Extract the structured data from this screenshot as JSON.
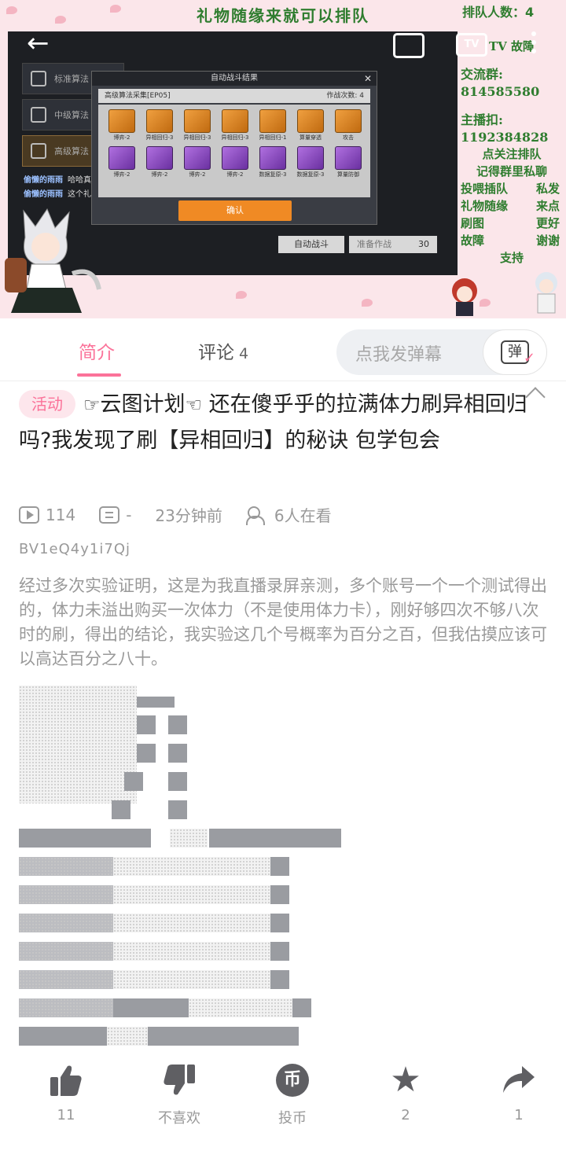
{
  "video": {
    "banner": "礼物随缘来就可以排队",
    "queue_label": "排队人数：4",
    "side_text": {
      "fault": "TV 故障",
      "group_label": "交流群:",
      "group_number": "814585580",
      "host_label": "主播扣:",
      "host_number": "1192384828",
      "lines_center": [
        "点关注排队",
        "记得群里私聊"
      ],
      "lines_two_col": [
        [
          "投喂插队",
          "私发"
        ],
        [
          "礼物随缘",
          "来点"
        ],
        [
          "刷图",
          "更好"
        ],
        [
          "故障",
          "谢谢"
        ]
      ],
      "support": "支持"
    },
    "game": {
      "menu": [
        "标准算法",
        "中级算法",
        "高级算法"
      ],
      "chat": [
        {
          "name": "偷懒的雨雨",
          "msg": "哈哈真不错"
        },
        {
          "name": "偷懒的雨雨",
          "msg": "这个礼物是我刷出来的吗"
        }
      ],
      "dialog_title": "自动战斗结果",
      "dialog_sub_left": "高级算法采集[EP05]",
      "dialog_sub_right": "作战次数: 4",
      "row1": [
        "博弈-2",
        "异相回归-3",
        "异相回归-3",
        "异相回归-3",
        "异相回归-1",
        "算量穿透",
        "攻击"
      ],
      "row2": [
        "博弈-2",
        "博弈-2",
        "博弈-2",
        "博弈-2",
        "数据复原-3",
        "数据复原-3",
        "算量防御"
      ],
      "confirm": "确认",
      "auto_battle": "自动战斗",
      "ready": "准备作战",
      "ready_cost": "30"
    }
  },
  "tabs": {
    "intro": "简介",
    "comments": "评论",
    "comments_count": "4",
    "danmaku_placeholder": "点我发弹幕",
    "danmaku_icon": "弹"
  },
  "post": {
    "badge": "活动",
    "title_part1": "云图计划",
    "title_part2": "还在傻乎乎的拉满体力刷异相回归吗?我发现了刷【异相回归】的秘诀 包学包会",
    "hand_left": "☞",
    "hand_right": "☜",
    "views": "114",
    "danmu": "-",
    "time": "23分钟前",
    "watching": "6人在看",
    "bvid": "BV1eQ4y1i7Qj",
    "description": "经过多次实验证明，这是为我直播录屏亲测，多个账号一个一个测试得出的，体力未溢出购买一次体力（不是使用体力卡），刚好够四次不够八次时的刷，得出的结论，我实验这几个号概率为百分之百，但我估摸应该可以高达百分之八十。"
  },
  "actions": {
    "like": "11",
    "dislike": "不喜欢",
    "coin": "投币",
    "coin_glyph": "币",
    "favorite": "2",
    "share": "1"
  },
  "colors": {
    "accent": "#fb7299",
    "banner_text": "#2f7d2f"
  }
}
